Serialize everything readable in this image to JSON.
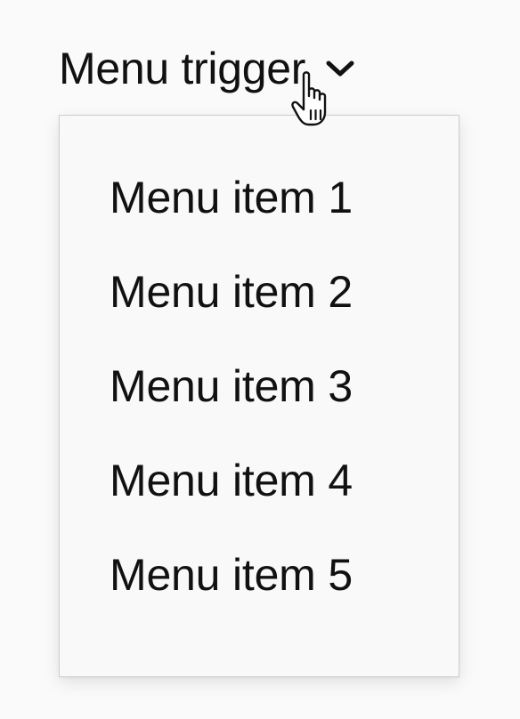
{
  "trigger": {
    "label": "Menu trigger",
    "icon": "chevron-down-icon"
  },
  "menu": {
    "items": [
      {
        "label": "Menu item 1"
      },
      {
        "label": "Menu item 2"
      },
      {
        "label": "Menu item 3"
      },
      {
        "label": "Menu item 4"
      },
      {
        "label": "Menu item 5"
      }
    ]
  },
  "cursor": {
    "icon": "hand-pointer-icon"
  },
  "colors": {
    "background": "#fafafa",
    "menu_background": "#f9f9f9",
    "menu_border": "#cfcfcf",
    "text": "#111111"
  }
}
